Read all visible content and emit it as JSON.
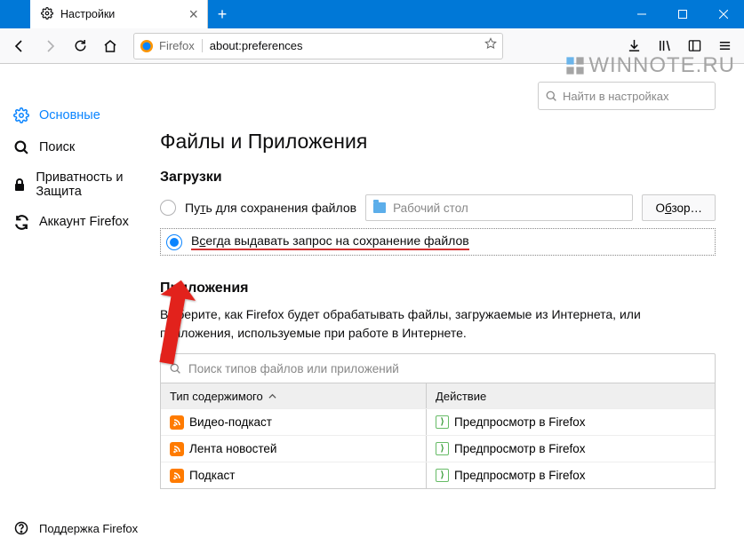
{
  "window": {
    "tab_title": "Настройки"
  },
  "urlbar": {
    "identity": "Firefox",
    "url": "about:preferences"
  },
  "watermark": "WINNOTE.RU",
  "sidebar": {
    "items": [
      {
        "label": "Основные"
      },
      {
        "label": "Поиск"
      },
      {
        "label": "Приватность и Защита"
      },
      {
        "label": "Аккаунт Firefox"
      }
    ],
    "support": "Поддержка Firefox"
  },
  "search": {
    "placeholder": "Найти в настройках"
  },
  "section": {
    "title": "Файлы и Приложения",
    "downloads": {
      "heading": "Загрузки",
      "path_label_pre": "Пу",
      "path_label_u": "т",
      "path_label_post": "ь для сохранения файлов",
      "folder": "Рабочий стол",
      "browse_pre": "О",
      "browse_u": "б",
      "browse_post": "зор…",
      "always_pre": "В",
      "always_u": "с",
      "always_post": "егда выдавать запрос на сохранение файлов"
    },
    "apps": {
      "heading": "Приложения",
      "desc": "Выберите, как Firefox будет обрабатывать файлы, загружаемые из Интернета, или приложения, используемые при работе в Интернете.",
      "search_placeholder": "Поиск типов файлов или приложений",
      "col1": "Тип содержимого",
      "col2": "Действие",
      "rows": [
        {
          "type": "Видео-подкаст",
          "action": "Предпросмотр в Firefox"
        },
        {
          "type": "Лента новостей",
          "action": "Предпросмотр в Firefox"
        },
        {
          "type": "Подкаст",
          "action": "Предпросмотр в Firefox"
        }
      ]
    }
  }
}
